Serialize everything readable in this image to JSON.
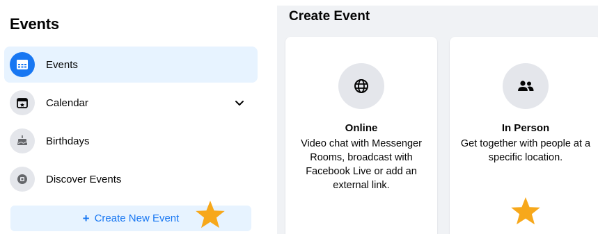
{
  "sidebar": {
    "title": "Events",
    "items": [
      {
        "label": "Events",
        "icon": "events-grid-icon",
        "active": true
      },
      {
        "label": "Calendar",
        "icon": "calendar-icon",
        "active": false
      },
      {
        "label": "Birthdays",
        "icon": "birthday-cake-icon",
        "active": false
      },
      {
        "label": "Discover Events",
        "icon": "discover-icon",
        "active": false
      }
    ],
    "create_button": {
      "plus": "+",
      "label": "Create New Event"
    }
  },
  "create_event": {
    "title": "Create Event",
    "cards": [
      {
        "title": "Online",
        "icon": "globe-icon",
        "description": "Video chat with Messenger Rooms, broadcast with Facebook Live or add an external link."
      },
      {
        "title": "In Person",
        "icon": "people-icon",
        "description": "Get together with people at a specific location."
      }
    ]
  },
  "colors": {
    "accent": "#1877f2",
    "active_bg": "#e7f3ff",
    "icon_bg": "#e4e6eb",
    "panel_bg": "#f0f2f5",
    "star": "#f7a81b"
  }
}
